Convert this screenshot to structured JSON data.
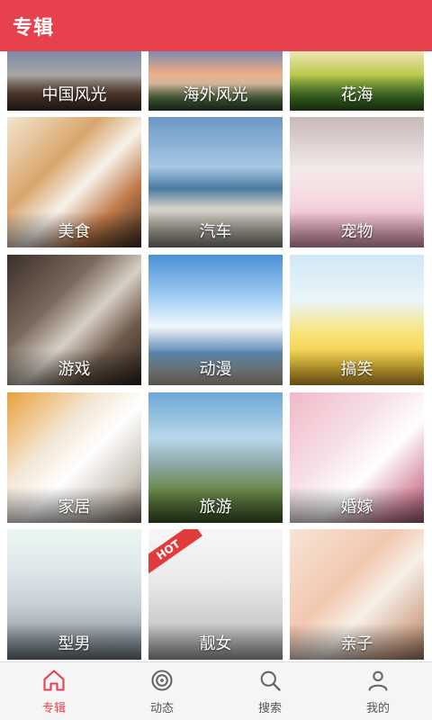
{
  "header": {
    "title": "专辑"
  },
  "tiles": [
    {
      "label": "中国风光"
    },
    {
      "label": "海外风光"
    },
    {
      "label": "花海"
    },
    {
      "label": "美食"
    },
    {
      "label": "汽车"
    },
    {
      "label": "宠物"
    },
    {
      "label": "游戏"
    },
    {
      "label": "动漫"
    },
    {
      "label": "搞笑"
    },
    {
      "label": "家居"
    },
    {
      "label": "旅游"
    },
    {
      "label": "婚嫁"
    },
    {
      "label": "型男"
    },
    {
      "label": "靓女",
      "badge": "HOT"
    },
    {
      "label": "亲子"
    }
  ],
  "tabbar": {
    "active_color": "#e8414e",
    "items": [
      {
        "label": "专辑",
        "icon": "home-icon",
        "active": true
      },
      {
        "label": "动态",
        "icon": "radar-icon",
        "active": false
      },
      {
        "label": "搜索",
        "icon": "search-icon",
        "active": false
      },
      {
        "label": "我的",
        "icon": "user-icon",
        "active": false
      }
    ]
  },
  "colors": {
    "header_bg": "#e8414e"
  }
}
